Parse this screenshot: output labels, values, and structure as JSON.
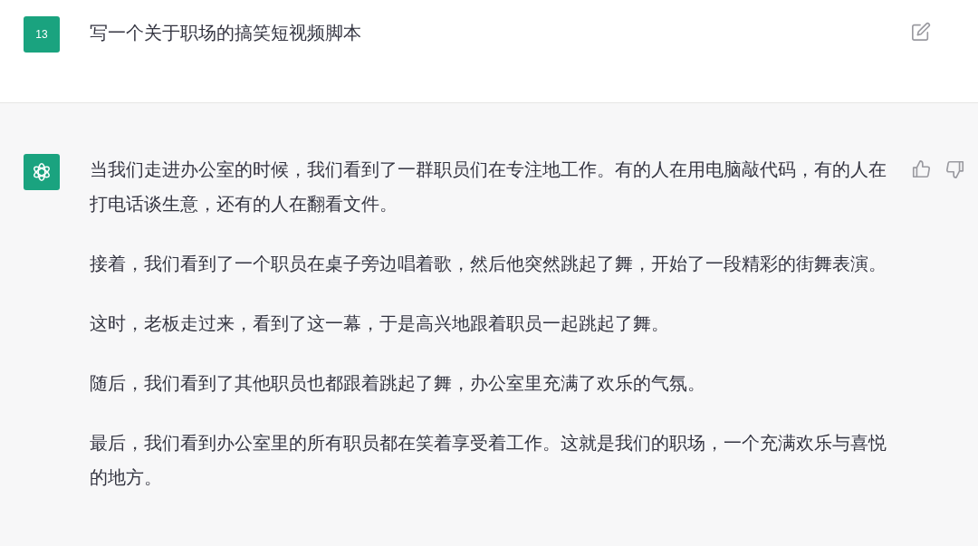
{
  "user_message": {
    "avatar": "13",
    "text": "写一个关于职场的搞笑短视频脚本"
  },
  "assistant_message": {
    "paragraphs": [
      "当我们走进办公室的时候，我们看到了一群职员们在专注地工作。有的人在用电脑敲代码，有的人在打电话谈生意，还有的人在翻看文件。",
      "接着，我们看到了一个职员在桌子旁边唱着歌，然后他突然跳起了舞，开始了一段精彩的街舞表演。",
      "这时，老板走过来，看到了这一幕，于是高兴地跟着职员一起跳起了舞。",
      "随后，我们看到了其他职员也都跟着跳起了舞，办公室里充满了欢乐的气氛。",
      "最后，我们看到办公室里的所有职员都在笑着享受着工作。这就是我们的职场，一个充满欢乐与喜悦的地方。"
    ]
  }
}
